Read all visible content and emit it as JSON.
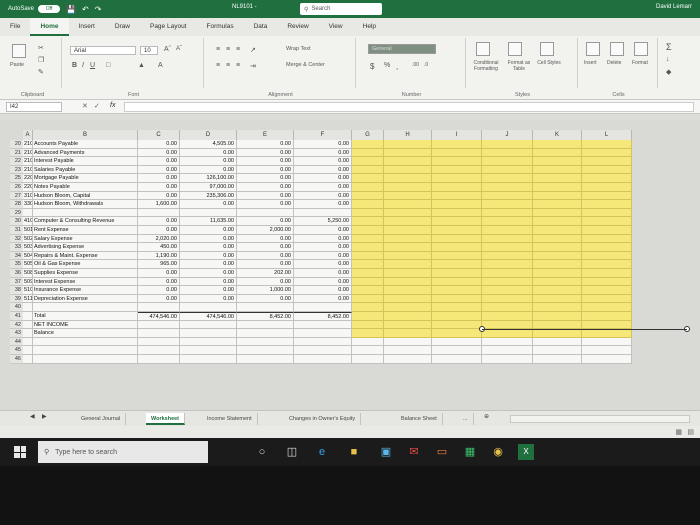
{
  "titlebar": {
    "autosave_label": "AutoSave",
    "autosave_state": "Off",
    "filename": "NL9101 -",
    "search": "Search",
    "user": "David Lemarr"
  },
  "tabs": [
    "File",
    "Home",
    "Insert",
    "Draw",
    "Page Layout",
    "Formulas",
    "Data",
    "Review",
    "View",
    "Help"
  ],
  "ribbon": {
    "paste": "Paste",
    "clipboard": "Clipboard",
    "font_name": "Arial",
    "font_size": "10",
    "font_group": "Font",
    "wrap_text": "Wrap Text",
    "merge_center": "Merge & Center",
    "alignment": "Alignment",
    "number_format": "General",
    "number_group": "Number",
    "conditional_formatting": "Conditional Formatting",
    "format_as_table": "Format as Table",
    "cell_styles": "Cell Styles",
    "styles_group": "Styles",
    "insert": "Insert",
    "delete": "Delete",
    "format": "Format",
    "cells_group": "Cells"
  },
  "formula_bar": {
    "name_box": "I42",
    "fx": "fx"
  },
  "columns": [
    "A",
    "B",
    "C",
    "D",
    "E",
    "F",
    "G",
    "H",
    "I",
    "J",
    "K",
    "L"
  ],
  "rows": [
    {
      "n": "20",
      "a": "2101",
      "b": "Accounts Payable",
      "c": "0.00",
      "d": "4,505.00",
      "e": "0.00",
      "f": "0.00"
    },
    {
      "n": "21",
      "a": "2102",
      "b": "Advanced Payments",
      "c": "0.00",
      "d": "0.00",
      "e": "0.00",
      "f": "0.00"
    },
    {
      "n": "22",
      "a": "2103",
      "b": "Interest Payable",
      "c": "0.00",
      "d": "0.00",
      "e": "0.00",
      "f": "0.00"
    },
    {
      "n": "23",
      "a": "2105",
      "b": "Salaries Payable",
      "c": "0.00",
      "d": "0.00",
      "e": "0.00",
      "f": "0.00"
    },
    {
      "n": "25",
      "a": "2201",
      "b": "Mortgage Payable",
      "c": "0.00",
      "d": "126,100.00",
      "e": "0.00",
      "f": "0.00"
    },
    {
      "n": "26",
      "a": "2202",
      "b": "Notes Payable",
      "c": "0.00",
      "d": "97,000.00",
      "e": "0.00",
      "f": "0.00"
    },
    {
      "n": "27",
      "a": "3100",
      "b": "Hudson Bloom, Capital",
      "c": "0.00",
      "d": "235,306.00",
      "e": "0.00",
      "f": "0.00"
    },
    {
      "n": "28",
      "a": "3300",
      "b": "Hudson Bloom, Withdrawals",
      "c": "1,600.00",
      "d": "0.00",
      "e": "0.00",
      "f": "0.00"
    },
    {
      "n": "29",
      "a": "",
      "b": "",
      "c": "",
      "d": "",
      "e": "",
      "f": ""
    },
    {
      "n": "30",
      "a": "4100",
      "b": "Computer & Consulting Revenue",
      "c": "0.00",
      "d": "11,635.00",
      "e": "0.00",
      "f": "5,250.00"
    },
    {
      "n": "31",
      "a": "5010",
      "b": "Rent Expense",
      "c": "0.00",
      "d": "0.00",
      "e": "2,000.00",
      "f": "0.00"
    },
    {
      "n": "32",
      "a": "5020",
      "b": "Salary Expense",
      "c": "2,020.00",
      "d": "0.00",
      "e": "0.00",
      "f": "0.00"
    },
    {
      "n": "33",
      "a": "5030",
      "b": "Advertising Expense",
      "c": "450.00",
      "d": "0.00",
      "e": "0.00",
      "f": "0.00"
    },
    {
      "n": "34",
      "a": "5040",
      "b": "Repairs & Maint. Expense",
      "c": "1,190.00",
      "d": "0.00",
      "e": "0.00",
      "f": "0.00"
    },
    {
      "n": "35",
      "a": "5050",
      "b": "Oil & Gas Expense",
      "c": "965.00",
      "d": "0.00",
      "e": "0.00",
      "f": "0.00"
    },
    {
      "n": "36",
      "a": "5080",
      "b": "Supplies Expense",
      "c": "0.00",
      "d": "0.00",
      "e": "202.00",
      "f": "0.00"
    },
    {
      "n": "37",
      "a": "5090",
      "b": "Interest Expense",
      "c": "0.00",
      "d": "0.00",
      "e": "0.00",
      "f": "0.00"
    },
    {
      "n": "38",
      "a": "5100",
      "b": "Insurance Expense",
      "c": "0.00",
      "d": "0.00",
      "e": "1,000.00",
      "f": "0.00"
    },
    {
      "n": "39",
      "a": "5110",
      "b": "Depreciation Expense",
      "c": "0.00",
      "d": "0.00",
      "e": "0.00",
      "f": "0.00"
    },
    {
      "n": "40",
      "a": "",
      "b": "",
      "c": "",
      "d": "",
      "e": "",
      "f": ""
    },
    {
      "n": "41",
      "a": "",
      "b": "Total",
      "c": "474,546.00",
      "d": "474,546.00",
      "e": "8,452.00",
      "f": "8,452.00"
    },
    {
      "n": "42",
      "a": "",
      "b": "NET INCOME",
      "c": "",
      "d": "",
      "e": "",
      "f": ""
    },
    {
      "n": "43",
      "a": "",
      "b": "Balance",
      "c": "",
      "d": "",
      "e": "",
      "f": ""
    },
    {
      "n": "44",
      "a": "",
      "b": "",
      "c": "",
      "d": "",
      "e": "",
      "f": ""
    },
    {
      "n": "45",
      "a": "",
      "b": "",
      "c": "",
      "d": "",
      "e": "",
      "f": ""
    },
    {
      "n": "46",
      "a": "",
      "b": "",
      "c": "",
      "d": "",
      "e": "",
      "f": ""
    }
  ],
  "sheets": [
    "General Journal",
    "Worksheet",
    "Income Statement",
    "Changes in Owner's Equity",
    "Balance Sheet",
    "..."
  ],
  "active_sheet": "Worksheet",
  "taskbar": {
    "search": "Type here to search"
  },
  "colors": {
    "excel_green": "#1f6f3f",
    "highlight_yellow": "#f6e878"
  }
}
